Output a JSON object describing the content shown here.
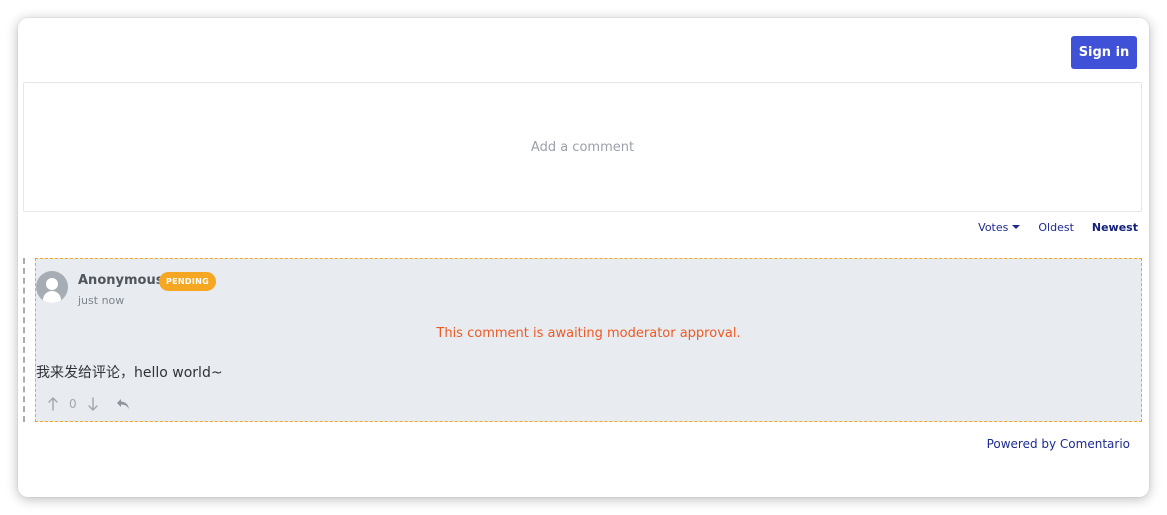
{
  "header": {
    "sign_in_label": "Sign in"
  },
  "composer": {
    "placeholder": "Add a comment"
  },
  "sort": {
    "options": [
      {
        "label": "Votes",
        "has_caret": true,
        "active": false
      },
      {
        "label": "Oldest",
        "active": false
      },
      {
        "label": "Newest",
        "active": true
      }
    ]
  },
  "comment": {
    "author": "Anonymous",
    "badge": "PENDING",
    "timestamp": "just now",
    "moderation_notice": "This comment is awaiting moderator approval.",
    "body": "我来发给评论，hello world~",
    "score": "0",
    "icons": {
      "upvote": "arrow-up-icon",
      "downvote": "arrow-down-icon",
      "reply": "reply-icon",
      "avatar": "avatar-icon"
    }
  },
  "footer": {
    "powered_by": "Powered by Comentario"
  },
  "colors": {
    "accent": "#3f51d6",
    "pending": "#f5a623",
    "moderation_text": "#ee5a24",
    "link": "#1d2b8f"
  }
}
